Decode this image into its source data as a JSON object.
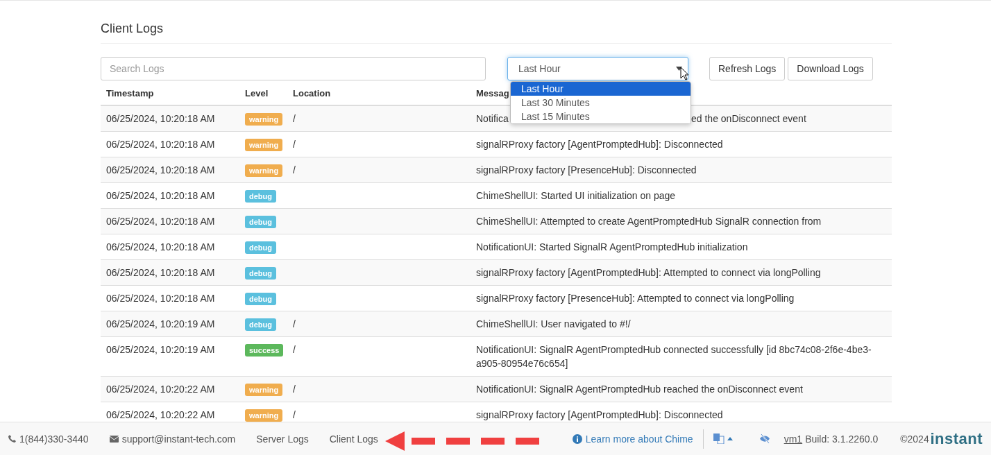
{
  "page_title": "Client Logs",
  "search": {
    "placeholder": "Search Logs"
  },
  "range_select": {
    "value": "Last Hour",
    "expanded": true,
    "options": [
      {
        "label": "Last Hour",
        "selected": true
      },
      {
        "label": "Last 30 Minutes",
        "selected": false
      },
      {
        "label": "Last 15 Minutes",
        "selected": false
      }
    ]
  },
  "buttons": [
    "Refresh Logs",
    "Download Logs"
  ],
  "table": {
    "columns": [
      "Timestamp",
      "Level",
      "Location",
      "Messag"
    ],
    "rows": [
      {
        "timestamp": "06/25/2024, 10:20:18 AM",
        "kind": "warning",
        "level_label": "warning",
        "location": "/",
        "message": "Notifica",
        "message_tail": "ed the onDisconnect event"
      },
      {
        "timestamp": "06/25/2024, 10:20:18 AM",
        "kind": "warning",
        "level_label": "warning",
        "location": "/",
        "message": "signalRProxy factory [AgentPromptedHub]: Disconnected"
      },
      {
        "timestamp": "06/25/2024, 10:20:18 AM",
        "kind": "warning",
        "level_label": "warning",
        "location": "/",
        "message": "signalRProxy factory [PresenceHub]: Disconnected"
      },
      {
        "timestamp": "06/25/2024, 10:20:18 AM",
        "kind": "debug",
        "level_label": "debug",
        "message": "ChimeShellUI: Started UI initialization on page"
      },
      {
        "timestamp": "06/25/2024, 10:20:18 AM",
        "kind": "debug",
        "level_label": "debug",
        "message": "ChimeShellUI: Attempted to create AgentPromptedHub SignalR connection from"
      },
      {
        "timestamp": "06/25/2024, 10:20:18 AM",
        "kind": "debug",
        "level_label": "debug",
        "message": "NotificationUI: Started SignalR AgentPromptedHub initialization"
      },
      {
        "timestamp": "06/25/2024, 10:20:18 AM",
        "kind": "debug",
        "level_label": "debug",
        "message": "signalRProxy factory [AgentPromptedHub]: Attempted to connect via longPolling"
      },
      {
        "timestamp": "06/25/2024, 10:20:18 AM",
        "kind": "debug",
        "level_label": "debug",
        "message": "signalRProxy factory [PresenceHub]: Attempted to connect via longPolling"
      },
      {
        "timestamp": "06/25/2024, 10:20:19 AM",
        "kind": "debug",
        "level_label": "debug",
        "location": "/",
        "message": "ChimeShellUI: User navigated to #!/"
      },
      {
        "timestamp": "06/25/2024, 10:20:19 AM",
        "kind": "success",
        "level_label": "success",
        "location": "/",
        "message": "NotificationUI: SignalR AgentPromptedHub connected successfully [id 8bc74c08-2f6e-4be3-a905-80954e76c654]"
      },
      {
        "timestamp": "06/25/2024, 10:20:22 AM",
        "kind": "warning",
        "level_label": "warning",
        "location": "/",
        "message": "NotificationUI: SignalR AgentPromptedHub reached the onDisconnect event"
      },
      {
        "timestamp": "06/25/2024, 10:20:22 AM",
        "kind": "warning",
        "level_label": "warning",
        "location": "/",
        "message": "signalRProxy factory [AgentPromptedHub]: Disconnected"
      }
    ]
  },
  "footer": {
    "phone": "1(844)330-3440",
    "email": "support@instant-tech.com",
    "links": [
      "Server Logs",
      "Client Logs"
    ],
    "learn_more": "Learn more about Chime",
    "host": "vm1",
    "build": "Build: 3.1.2260.0",
    "copyright": "©2024",
    "logo": "instant"
  }
}
